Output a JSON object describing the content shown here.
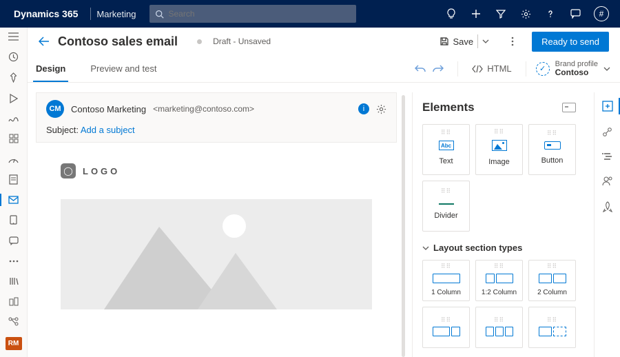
{
  "topbar": {
    "brand": "Dynamics 365",
    "app": "Marketing",
    "search_placeholder": "Search",
    "avatar_symbol": "#"
  },
  "cmd": {
    "title": "Contoso sales email",
    "status": "Draft - Unsaved",
    "save_label": "Save",
    "primary_label": "Ready to send"
  },
  "tabs": {
    "design": "Design",
    "preview": "Preview and test",
    "html_label": "HTML",
    "brand_profile_label": "Brand profile",
    "brand_profile_value": "Contoso"
  },
  "email": {
    "sender_initials": "CM",
    "sender_name": "Contoso Marketing",
    "sender_email": "<marketing@contoso.com>",
    "subject_label": "Subject:",
    "subject_link": "Add a subject",
    "logo_text": "LOGO"
  },
  "panel": {
    "title": "Elements",
    "text_label": "Text",
    "image_label": "Image",
    "button_label": "Button",
    "divider_label": "Divider",
    "layout_header": "Layout section types",
    "col1": "1 Column",
    "col12": "1:2 Column",
    "col2": "2 Column"
  },
  "left_nav": {
    "user_initials": "RM"
  }
}
